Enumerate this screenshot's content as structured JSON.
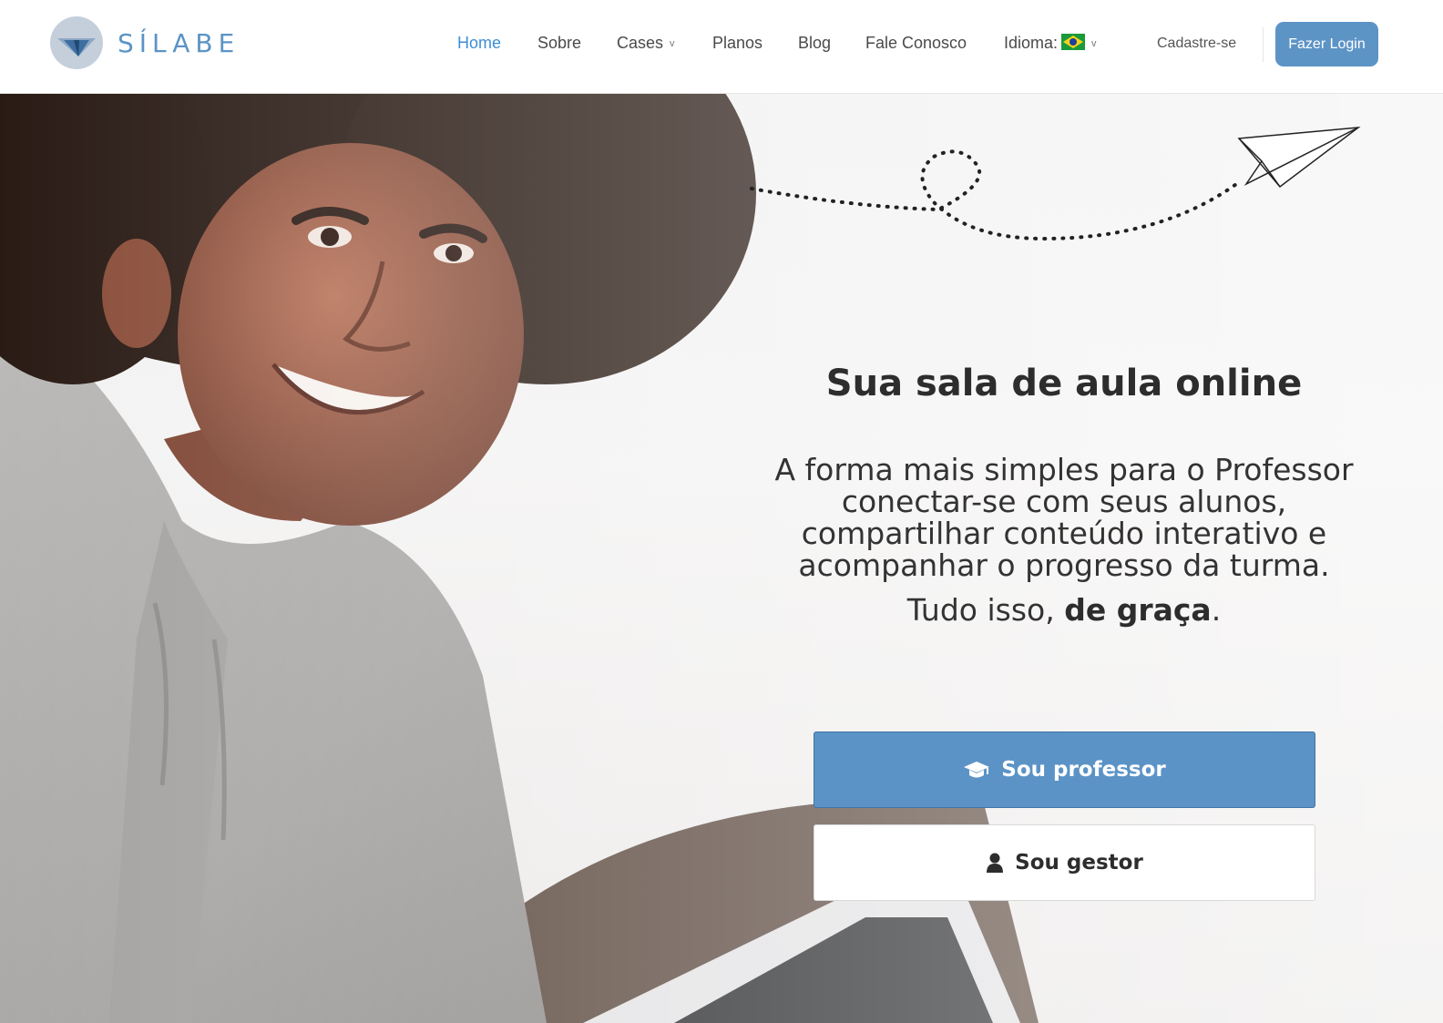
{
  "brand": {
    "name": "SÍLABE"
  },
  "nav": {
    "home": "Home",
    "about": "Sobre",
    "cases": "Cases",
    "plans": "Planos",
    "blog": "Blog",
    "contact": "Fale Conosco",
    "language": "Idioma:",
    "caret": "v"
  },
  "auth": {
    "signup": "Cadastre-se",
    "login": "Fazer Login"
  },
  "hero": {
    "title": "Sua sala de aula online",
    "description": "A forma mais simples para o Professor conectar-se com seus alunos, compartilhar conteúdo interativo e acompanhar o progresso da turma.",
    "free_prefix": "Tudo isso, ",
    "free_bold": "de graça",
    "free_suffix": "."
  },
  "cta": {
    "teacher": "Sou professor",
    "manager": "Sou gestor"
  },
  "icons": {
    "logo": "paper-plane-logo-icon",
    "flag": "brazil-flag-icon",
    "teacher": "graduation-cap-icon",
    "manager": "user-icon",
    "trail": "paper-plane-icon"
  },
  "colors": {
    "accent": "#5b93c6",
    "nav_active": "#3d8fd8",
    "brand_text": "#5b94c5"
  }
}
